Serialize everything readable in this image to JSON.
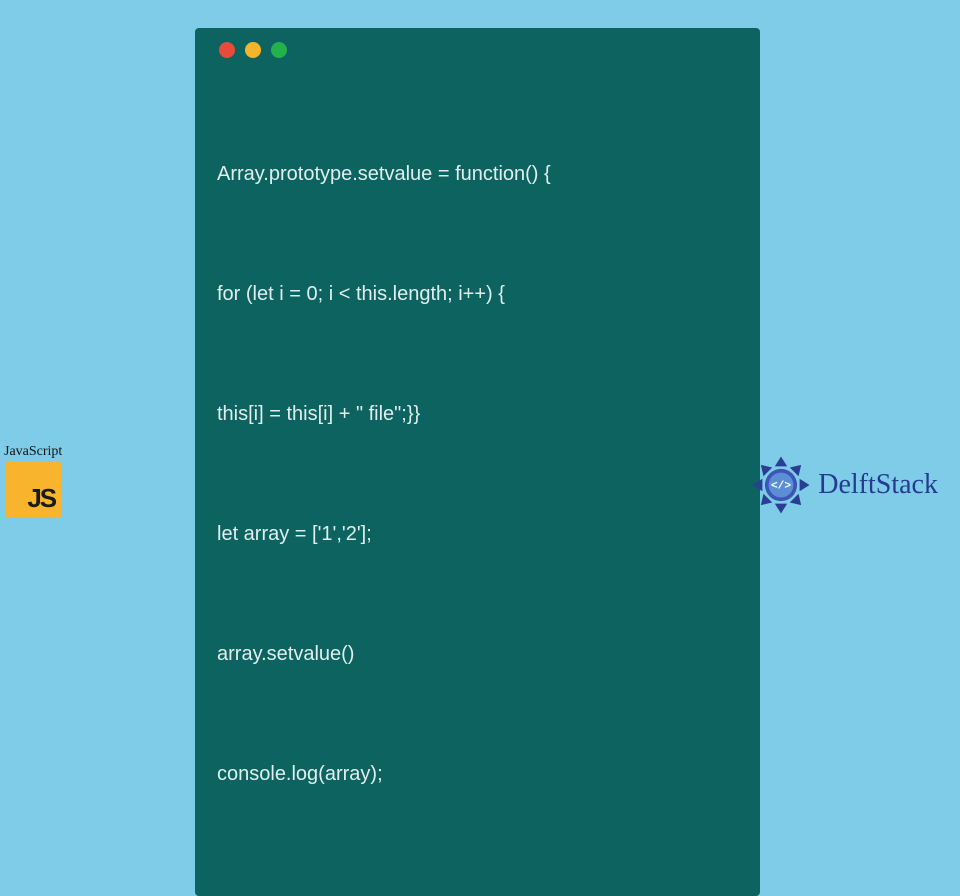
{
  "code": {
    "lines": [
      "Array.prototype.setvalue = function() {",
      "for (let i = 0; i < this.length; i++) {",
      "this[i] = this[i] + \" file\";}}",
      "let array = ['1','2'];",
      "array.setvalue()",
      "console.log(array);"
    ]
  },
  "window_buttons": {
    "red": "#e84b3c",
    "yellow": "#f5b52a",
    "green": "#23b14d"
  },
  "js_badge": {
    "label": "JavaScript",
    "short": "JS"
  },
  "delft": {
    "text": "DelftStack"
  },
  "colors": {
    "page_bg": "#7ecce8",
    "code_bg": "#0d6360",
    "code_fg": "#dfeeee",
    "js_bg": "#f7b42c",
    "delft_blue": "#243b8f"
  }
}
